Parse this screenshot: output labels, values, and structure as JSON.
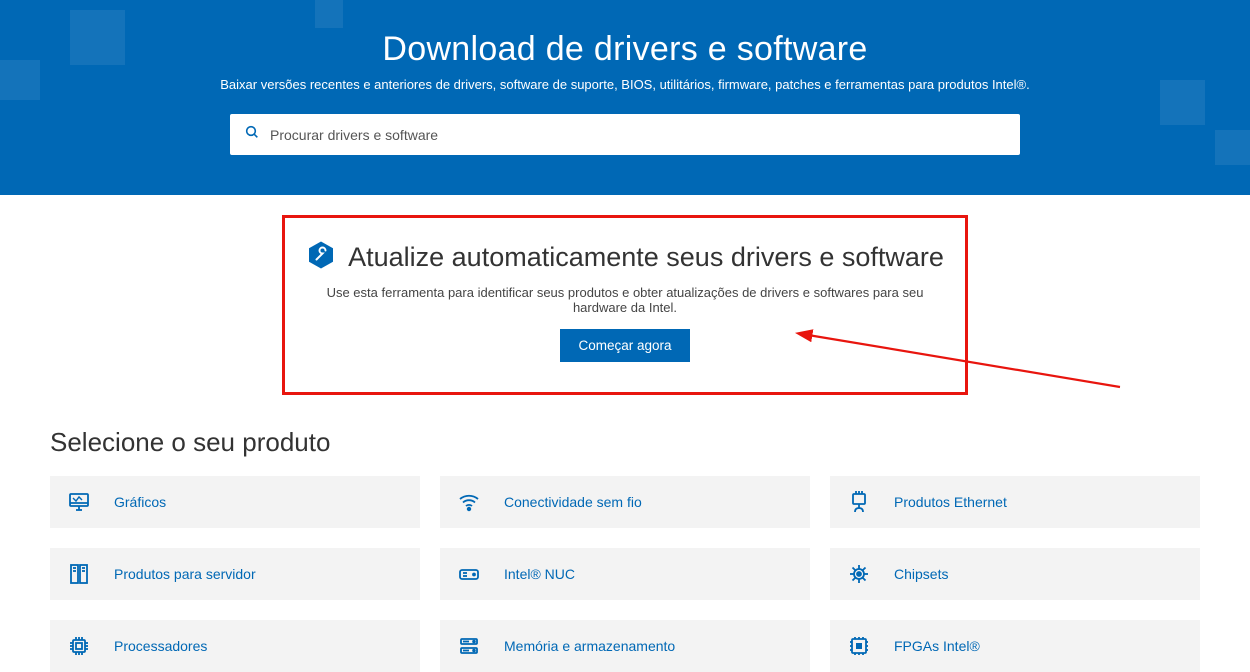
{
  "hero": {
    "title": "Download de drivers e software",
    "subtitle": "Baixar versões recentes e anteriores de drivers, software de suporte, BIOS, utilitários, firmware, patches e ferramentas para produtos Intel®."
  },
  "search": {
    "placeholder": "Procurar drivers e software"
  },
  "autoUpdate": {
    "heading": "Atualize automaticamente seus drivers e software",
    "description": "Use esta ferramenta para identificar seus produtos e obter atualizações de drivers e softwares para seu hardware da Intel.",
    "cta": "Começar agora"
  },
  "selectProduct": {
    "title": "Selecione o seu produto",
    "cards": [
      {
        "label": "Gráficos"
      },
      {
        "label": "Conectividade sem fio"
      },
      {
        "label": "Produtos Ethernet"
      },
      {
        "label": "Produtos para servidor"
      },
      {
        "label": "Intel® NUC"
      },
      {
        "label": "Chipsets"
      },
      {
        "label": "Processadores"
      },
      {
        "label": "Memória e armazenamento"
      },
      {
        "label": "FPGAs Intel®"
      }
    ]
  },
  "colors": {
    "brand": "#0068b5",
    "highlight": "#e8150e"
  }
}
